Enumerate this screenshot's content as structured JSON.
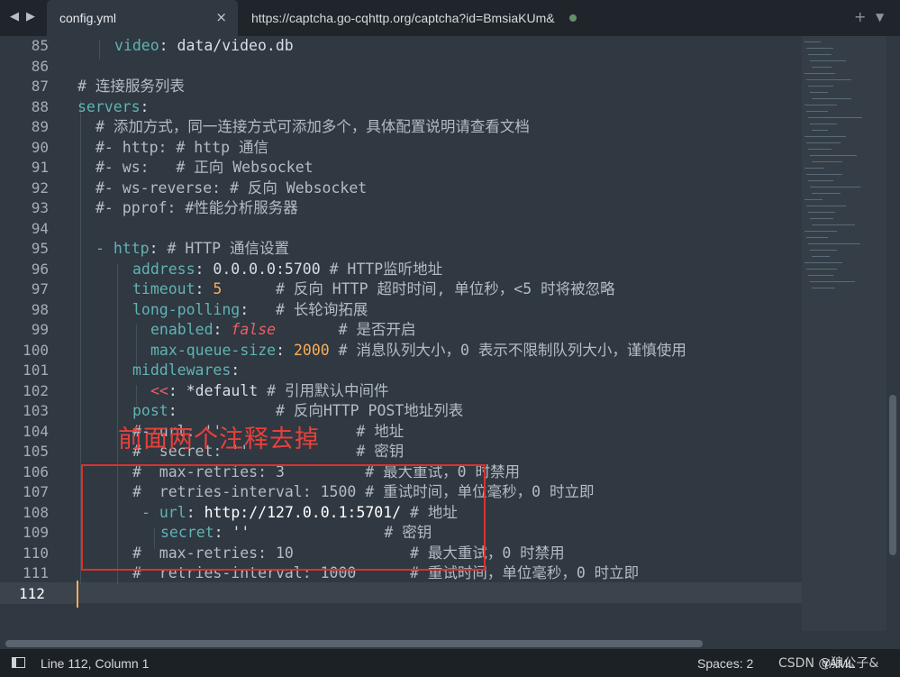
{
  "tabs": {
    "active": {
      "label": "config.yml",
      "close": "×"
    },
    "inactive": {
      "label": "https://captcha.go-cqhttp.org/captcha?id=BmsiaKUm&"
    },
    "nav_back": "◀",
    "nav_forward": "▶",
    "new_tab": "+",
    "tab_menu": "▼"
  },
  "line_numbers": [
    "85",
    "86",
    "87",
    "88",
    "89",
    "90",
    "91",
    "92",
    "93",
    "94",
    "95",
    "96",
    "97",
    "98",
    "99",
    "100",
    "101",
    "102",
    "103",
    "104",
    "105",
    "106",
    "107",
    "108",
    "109",
    "110",
    "111",
    "112"
  ],
  "current_line": "112",
  "code": {
    "l85": {
      "key": "video",
      "sep": ": ",
      "val": "data/video.db"
    },
    "l87": {
      "comment": "# 连接服务列表"
    },
    "l88": {
      "key": "servers",
      "sep": ":"
    },
    "l89": {
      "comment": "# 添加方式，同一连接方式可添加多个，具体配置说明请查看文档"
    },
    "l90": {
      "comment": "#- http: # http 通信"
    },
    "l91": {
      "comment": "#- ws:   # 正向 Websocket"
    },
    "l92": {
      "comment": "#- ws-reverse: # 反向 Websocket"
    },
    "l93": {
      "comment": "#- pprof: #性能分析服务器"
    },
    "l95": {
      "dash": "- ",
      "key": "http",
      "sep": ": ",
      "comment": "# HTTP 通信设置"
    },
    "l96": {
      "key": "address",
      "sep": ": ",
      "val": "0.0.0.0:5700 ",
      "comment": "# HTTP监听地址"
    },
    "l97": {
      "key": "timeout",
      "sep": ": ",
      "num": "5",
      "pad": "      ",
      "comment": "# 反向 HTTP 超时时间, 单位秒，<5 时将被忽略"
    },
    "l98": {
      "key": "long-polling",
      "sep": ":",
      "pad": "   ",
      "comment": "# 长轮询拓展"
    },
    "l99": {
      "key": "enabled",
      "sep": ": ",
      "bool": "false",
      "pad": "       ",
      "comment": "# 是否开启"
    },
    "l100": {
      "key": "max-queue-size",
      "sep": ": ",
      "num": "2000",
      "pad": " ",
      "comment": "# 消息队列大小，0 表示不限制队列大小，谨慎使用"
    },
    "l101": {
      "key": "middlewares",
      "sep": ":"
    },
    "l102": {
      "anchor": "<<",
      "sep": ": ",
      "val": "*default",
      "pad": " ",
      "comment": "# 引用默认中间件"
    },
    "l103": {
      "key": "post",
      "sep": ":",
      "pad": "           ",
      "comment": "# 反向HTTP POST地址列表"
    },
    "l104": {
      "comment": "#- url: ''               # 地址"
    },
    "l105": {
      "comment": "#  secret: ''            # 密钥"
    },
    "l106": {
      "comment": "#  max-retries: 3         # 最大重试，0 时禁用"
    },
    "l107": {
      "comment": "#  retries-interval: 1500 # 重试时间，单位毫秒，0 时立即"
    },
    "l108": {
      "dash": "- ",
      "key": "url",
      "sep": ": ",
      "val": "http://127.0.0.1:5701/",
      "pad": " ",
      "comment": "# 地址"
    },
    "l109": {
      "key": "secret",
      "sep": ": ",
      "val": "''",
      "pad": "               ",
      "comment": "# 密钥"
    },
    "l110": {
      "comment": "#  max-retries: 10             # 最大重试，0 时禁用"
    },
    "l111": {
      "comment": "#  retries-interval: 1000      # 重试时间，单位毫秒，0 时立即"
    }
  },
  "annotation": {
    "text": "前面两个注释去掉"
  },
  "status": {
    "position": "Line 112, Column 1",
    "spaces": "Spaces: 2",
    "syntax": "YAML",
    "watermark": "CSDN @狼公子&"
  },
  "colors": {
    "background": "#303841",
    "key": "#5fb4b4",
    "number": "#f9ae58",
    "boolean": "#ec5f66",
    "annotation": "#e9403b"
  }
}
